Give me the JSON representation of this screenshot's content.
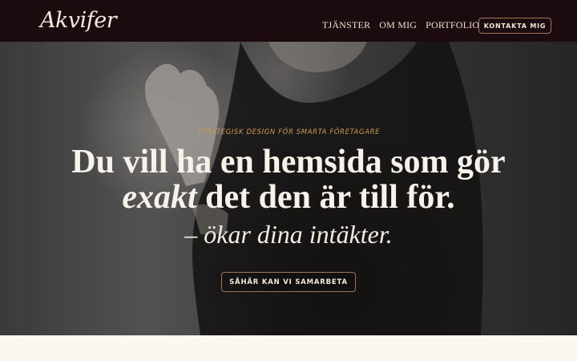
{
  "brand": {
    "logo_text": "Akvifer"
  },
  "nav": {
    "items": [
      "TJÄNSTER",
      "OM MIG",
      "PORTFOLIO"
    ],
    "cta_label": "KONTAKTA MIG"
  },
  "hero": {
    "tagline": "STRATEGISK DESIGN FÖR SMARTA FÖRETAGARE",
    "headline_line1": "Du vill ha en hemsida som gör",
    "headline_line2_emphasis": "exakt",
    "headline_line2_rest": " det den är till för.",
    "subhead": "– ökar dina intäkter.",
    "button_label": "SÅHÄR KAN VI SAMARBETA"
  },
  "colors": {
    "topbar_bg": "#1c0b0e",
    "accent_gold": "#c99c52",
    "page_bg": "#fbf8f1"
  }
}
